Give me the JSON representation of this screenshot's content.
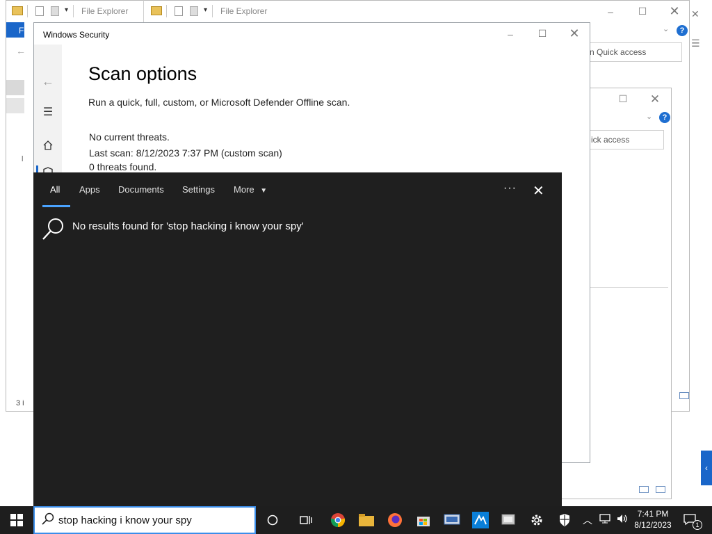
{
  "file_explorer_1": {
    "title": "File Explorer",
    "status": "3 i",
    "nav_letter": "F"
  },
  "file_explorer_2": {
    "title": "File Explorer",
    "quick_access": "n Quick access"
  },
  "file_explorer_3": {
    "quick_access": "ick access"
  },
  "security": {
    "title": "Windows Security",
    "heading": "Scan options",
    "subtitle": "Run a quick, full, custom, or Microsoft Defender Offline scan.",
    "threat_status": "No current threats.",
    "last_scan": "Last scan: 8/12/2023 7:37 PM (custom scan)",
    "threats_found": "0 threats found."
  },
  "search_panel": {
    "tabs": [
      {
        "label": "All"
      },
      {
        "label": "Apps"
      },
      {
        "label": "Documents"
      },
      {
        "label": "Settings"
      },
      {
        "label": "More"
      }
    ],
    "no_results": "No results found for 'stop hacking i know your spy'"
  },
  "taskbar": {
    "search_value": "stop hacking i know your spy",
    "time": "7:41 PM",
    "date": "8/12/2023",
    "notification_count": "1"
  },
  "colors": {
    "accent": "#3b8eea",
    "search_bg": "#1f1f1f",
    "taskbar_bg": "#1e1e1e"
  }
}
